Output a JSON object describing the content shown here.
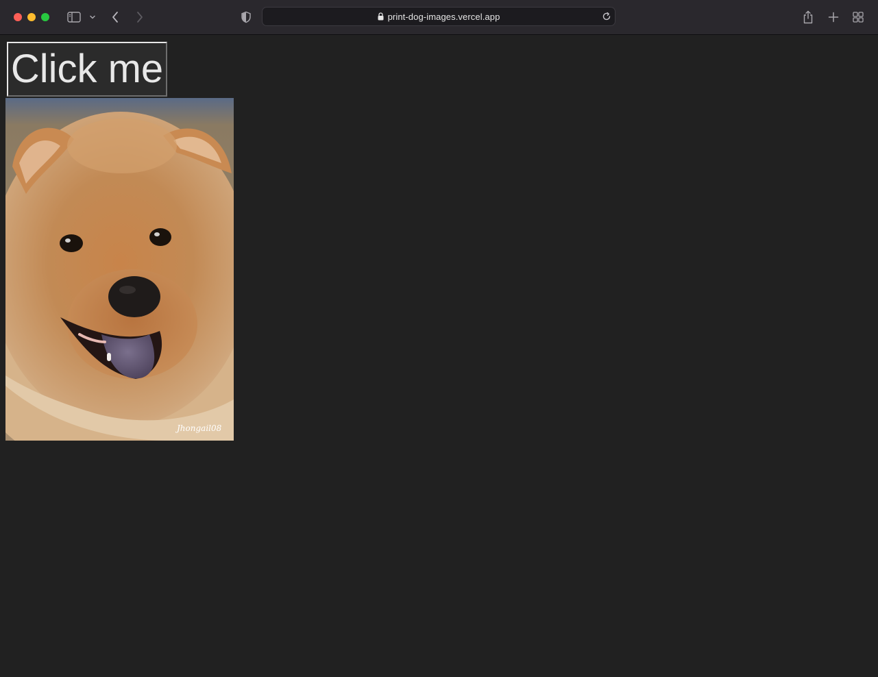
{
  "browser": {
    "url": "print-dog-images.vercel.app",
    "icons": {
      "sidebar": "sidebar-icon",
      "sidebar_menu": "chevron-down-icon",
      "back": "back-icon",
      "forward": "forward-icon",
      "privacy": "shield-icon",
      "lock": "lock-icon",
      "reload": "reload-icon",
      "share": "share-icon",
      "new_tab": "plus-icon",
      "tab_overview": "tab-grid-icon"
    },
    "traffic_lights": {
      "close": "#fe5f57",
      "minimize": "#febc2e",
      "maximize": "#28c840"
    }
  },
  "page": {
    "background": "#212121",
    "button_label": "Click me",
    "image": {
      "subject": "dog-photo",
      "watermark": "Jhongail08"
    }
  }
}
